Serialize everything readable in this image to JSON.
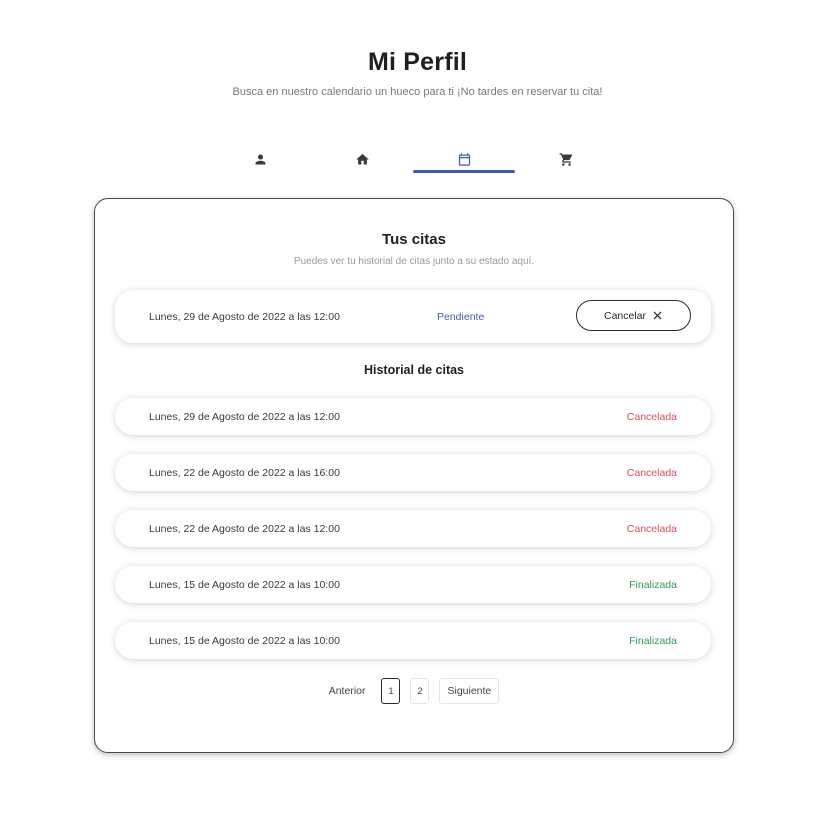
{
  "header": {
    "title": "Mi Perfil",
    "subtitle": "Busca en nuestro calendario un hueco para ti ¡No tardes en reservar tu cita!"
  },
  "tabs": [
    {
      "icon": "person-icon",
      "active": false
    },
    {
      "icon": "home-icon",
      "active": false
    },
    {
      "icon": "calendar-icon",
      "active": true
    },
    {
      "icon": "cart-icon",
      "active": false
    }
  ],
  "colors": {
    "accent": "#3f5bb3",
    "cancelled": "#d94d5b",
    "finished": "#2e9a5e",
    "border": "#4a4a4a"
  },
  "citas": {
    "title": "Tus citas",
    "subtitle": "Puedes ver tu historial de citas junto a su estado aquí.",
    "upcoming": {
      "date": "Lunes, 29 de Agosto de 2022 a las 12:00",
      "status": "Pendiente",
      "cancel_label": "Cancelar"
    }
  },
  "history": {
    "title": "Historial de citas",
    "items": [
      {
        "date": "Lunes, 29 de Agosto de 2022 a las 12:00",
        "status": "Cancelada"
      },
      {
        "date": "Lunes, 22 de Agosto de 2022 a las 16:00",
        "status": "Cancelada"
      },
      {
        "date": "Lunes, 22 de Agosto de 2022 a las 12:00",
        "status": "Cancelada"
      },
      {
        "date": "Lunes, 15 de Agosto de 2022 a las 10:00",
        "status": "Finalizada"
      },
      {
        "date": "Lunes, 15 de Agosto de 2022 a las 10:00",
        "status": "Finalizada"
      }
    ]
  },
  "pagination": {
    "prev_label": "Anterior",
    "pages": [
      "1",
      "2"
    ],
    "current": "1",
    "next_label": "Siguiente"
  }
}
